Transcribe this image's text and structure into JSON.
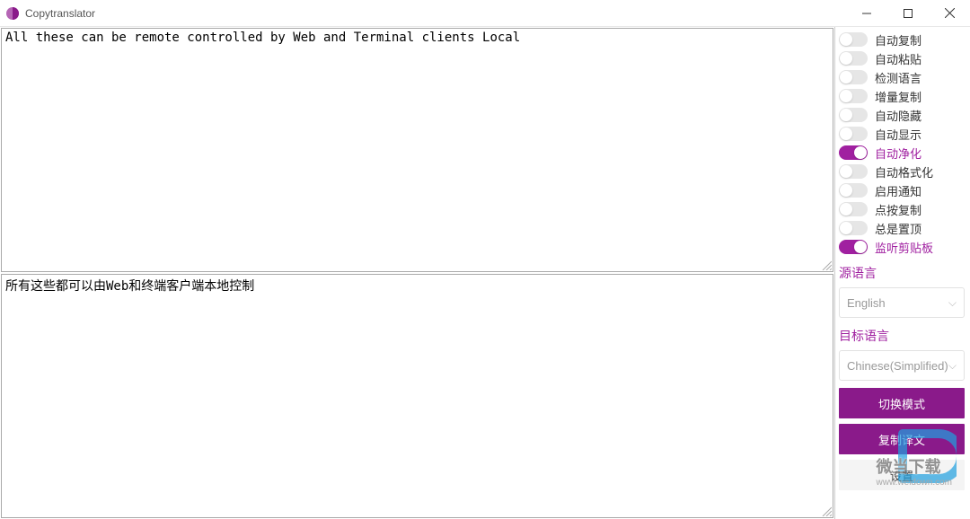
{
  "app": {
    "title": "Copytranslator"
  },
  "source_text": "All these can be remote controlled by Web and Terminal clients Local",
  "target_text": "所有这些都可以由Web和终端客户端本地控制",
  "toggles": [
    {
      "label": "自动复制",
      "on": false
    },
    {
      "label": "自动粘贴",
      "on": false
    },
    {
      "label": "检测语言",
      "on": false
    },
    {
      "label": "增量复制",
      "on": false
    },
    {
      "label": "自动隐藏",
      "on": false
    },
    {
      "label": "自动显示",
      "on": false
    },
    {
      "label": "自动净化",
      "on": true
    },
    {
      "label": "自动格式化",
      "on": false
    },
    {
      "label": "启用通知",
      "on": false
    },
    {
      "label": "点按复制",
      "on": false
    },
    {
      "label": "总是置顶",
      "on": false
    },
    {
      "label": "监听剪贴板",
      "on": true
    }
  ],
  "source_lang": {
    "title": "源语言",
    "value": "English"
  },
  "target_lang": {
    "title": "目标语言",
    "value": "Chinese(Simplified)"
  },
  "buttons": {
    "switch_mode": "切换模式",
    "copy_result": "复制译文",
    "settings": "设置"
  },
  "watermark": {
    "text": "微当下载",
    "url": "www.weidown.com"
  }
}
